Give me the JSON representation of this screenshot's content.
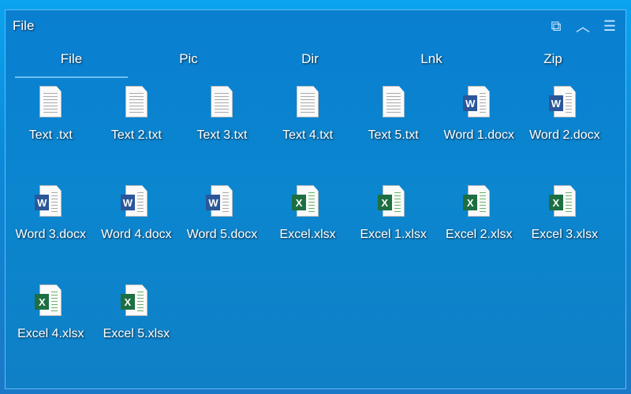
{
  "window": {
    "title": "File"
  },
  "tabs": [
    "File",
    "Pic",
    "Dir",
    "Lnk",
    "Zip"
  ],
  "colors": {
    "word": "#2b579a",
    "excel": "#1d6f42"
  },
  "files": [
    {
      "name": "Text .txt",
      "type": "text"
    },
    {
      "name": "Text 2.txt",
      "type": "text"
    },
    {
      "name": "Text 3.txt",
      "type": "text"
    },
    {
      "name": "Text 4.txt",
      "type": "text"
    },
    {
      "name": "Text 5.txt",
      "type": "text"
    },
    {
      "name": "Word 1.docx",
      "type": "word"
    },
    {
      "name": "Word 2.docx",
      "type": "word"
    },
    {
      "name": "Word 3.docx",
      "type": "word"
    },
    {
      "name": "Word 4.docx",
      "type": "word"
    },
    {
      "name": "Word 5.docx",
      "type": "word"
    },
    {
      "name": "Excel.xlsx",
      "type": "excel"
    },
    {
      "name": "Excel 1.xlsx",
      "type": "excel"
    },
    {
      "name": "Excel 2.xlsx",
      "type": "excel"
    },
    {
      "name": "Excel 3.xlsx",
      "type": "excel"
    },
    {
      "name": "Excel 4.xlsx",
      "type": "excel"
    },
    {
      "name": "Excel 5.xlsx",
      "type": "excel"
    }
  ],
  "badges": {
    "word": "W",
    "excel": "X"
  }
}
